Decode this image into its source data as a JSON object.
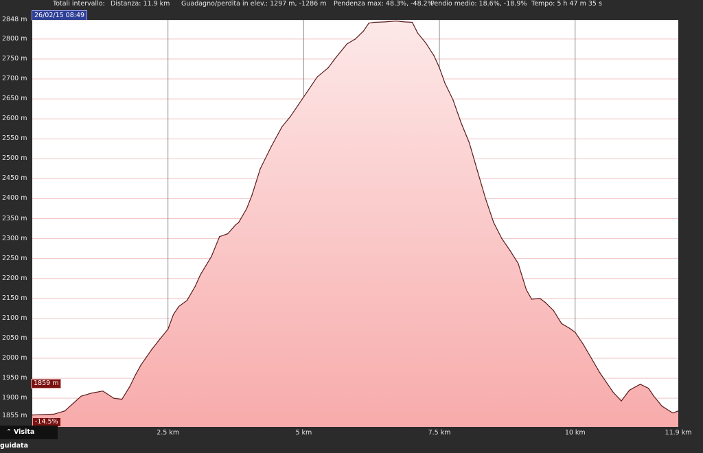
{
  "summary": {
    "label": "Totali intervallo:",
    "distance": "Distanza: 11.9 km",
    "gain_loss": "Guadagno/perdita in elev.: 1297 m, -1286 m",
    "max_grade": "Pendenza max: 48.3%, -48.2%",
    "avg_grade": "Pendio medio: 18.6%, -18.9%",
    "time": "Tempo: 5 h 47 m 35 s"
  },
  "date_badge": "26/02/15 08:49",
  "cursor": {
    "elevation_label": "1859 m",
    "grade_label": "-14.5%"
  },
  "guide_button": {
    "icon": "double-chevron-up-icon",
    "label": "Visita guidata"
  },
  "colors": {
    "line": "#5a1a1a",
    "fill_top": "#fde8e8",
    "fill_bottom": "#f8abab",
    "background": "#2b2b2b"
  },
  "chart_data": {
    "type": "area",
    "xlabel": "",
    "ylabel": "",
    "xlim": [
      0,
      11.9
    ],
    "ylim": [
      1828,
      2848
    ],
    "grid": true,
    "y_ticks": [
      "1855 m",
      "1900 m",
      "1950 m",
      "2000 m",
      "2050 m",
      "2100 m",
      "2150 m",
      "2200 m",
      "2250 m",
      "2300 m",
      "2350 m",
      "2400 m",
      "2450 m",
      "2500 m",
      "2550 m",
      "2600 m",
      "2650 m",
      "2700 m",
      "2750 m",
      "2800 m",
      "2848 m"
    ],
    "y_tick_values": [
      1855,
      1900,
      1950,
      2000,
      2050,
      2100,
      2150,
      2200,
      2250,
      2300,
      2350,
      2400,
      2450,
      2500,
      2550,
      2600,
      2650,
      2700,
      2750,
      2800,
      2848
    ],
    "x_ticks": [
      "2.5 km",
      "5 km",
      "7.5 km",
      "10 km",
      "11.9 km"
    ],
    "x_tick_values": [
      2.5,
      5,
      7.5,
      10,
      11.9
    ],
    "series": [
      {
        "x": [
          0,
          0.4,
          0.6,
          0.9,
          1.1,
          1.3,
          1.5,
          1.65,
          1.8,
          1.9,
          2.0,
          2.2,
          2.35,
          2.5,
          2.6,
          2.7,
          2.85,
          3.0,
          3.1,
          3.3,
          3.45,
          3.6,
          3.75,
          3.8,
          3.95,
          4.05,
          4.2,
          4.4,
          4.6,
          4.75,
          4.9,
          5.05,
          5.25,
          5.45,
          5.6,
          5.8,
          5.95,
          6.1,
          6.2,
          6.3,
          6.5,
          6.7,
          6.85,
          7.0,
          7.1,
          7.25,
          7.4,
          7.5,
          7.6,
          7.75,
          7.9,
          8.05,
          8.2,
          8.35,
          8.5,
          8.65,
          8.8,
          8.95,
          9.1,
          9.2,
          9.35,
          9.45,
          9.6,
          9.75,
          9.9,
          10.0,
          10.15,
          10.3,
          10.45,
          10.6,
          10.7,
          10.85,
          11.0,
          11.2,
          11.35,
          11.45,
          11.6,
          11.8,
          11.9
        ],
        "y": [
          1858,
          1860,
          1868,
          1905,
          1913,
          1918,
          1900,
          1897,
          1930,
          1958,
          1983,
          2022,
          2048,
          2073,
          2110,
          2130,
          2145,
          2180,
          2210,
          2255,
          2305,
          2312,
          2335,
          2340,
          2375,
          2410,
          2475,
          2530,
          2580,
          2605,
          2635,
          2665,
          2705,
          2728,
          2755,
          2788,
          2800,
          2820,
          2840,
          2842,
          2843,
          2845,
          2843,
          2842,
          2815,
          2790,
          2758,
          2728,
          2690,
          2648,
          2590,
          2540,
          2470,
          2400,
          2340,
          2300,
          2270,
          2238,
          2172,
          2148,
          2150,
          2140,
          2120,
          2087,
          2075,
          2065,
          2035,
          2000,
          1965,
          1935,
          1915,
          1893,
          1920,
          1935,
          1925,
          1905,
          1880,
          1863,
          1868
        ]
      }
    ]
  }
}
